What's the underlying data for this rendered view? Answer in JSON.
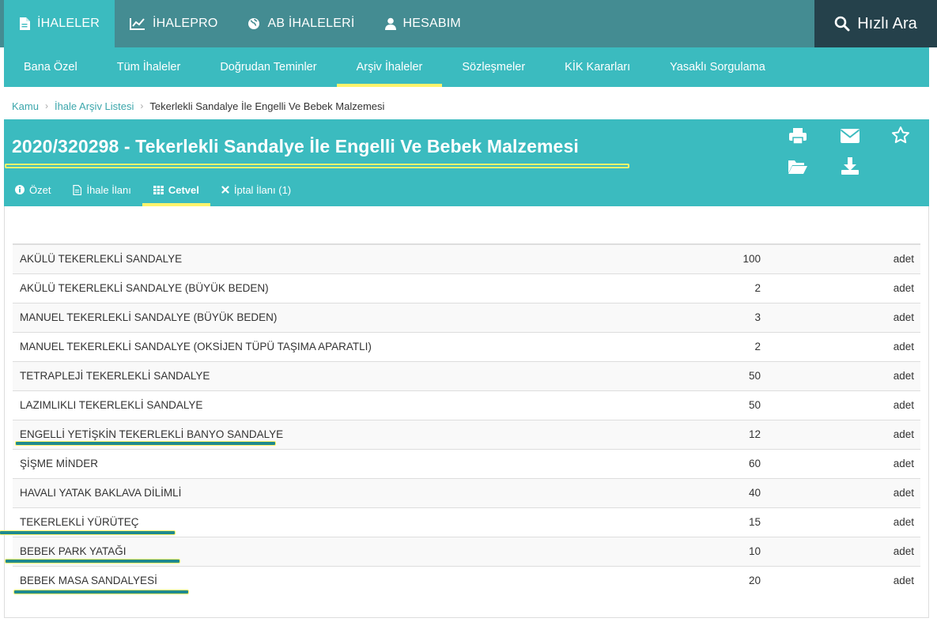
{
  "topnav": {
    "items": [
      {
        "label": "İHALELER",
        "icon": "document-icon",
        "active": true
      },
      {
        "label": "İHALEPRO",
        "icon": "chart-line-icon",
        "active": false
      },
      {
        "label": "AB İHALELERİ",
        "icon": "globe-icon",
        "active": false
      },
      {
        "label": "HESABIM",
        "icon": "user-icon",
        "active": false
      }
    ],
    "quick_search": "Hızlı Ara"
  },
  "subnav": {
    "items": [
      {
        "label": "Bana Özel",
        "active": false
      },
      {
        "label": "Tüm İhaleler",
        "active": false
      },
      {
        "label": "Doğrudan Teminler",
        "active": false
      },
      {
        "label": "Arşiv İhaleler",
        "active": true
      },
      {
        "label": "Sözleşmeler",
        "active": false
      },
      {
        "label": "KİK Kararları",
        "active": false
      },
      {
        "label": "Yasaklı Sorgulama",
        "active": false
      }
    ]
  },
  "breadcrumb": {
    "items": [
      "Kamu",
      "İhale Arşiv Listesi"
    ],
    "current": "Tekerlekli Sandalye İle Engelli Ve Bebek Malzemesi"
  },
  "header": {
    "title": "2020/320298 - Tekerlekli Sandalye İle Engelli Ve Bebek Malzemesi",
    "actions": [
      "print-icon",
      "envelope-icon",
      "star-icon",
      "folder-open-icon",
      "download-icon"
    ]
  },
  "tabs": [
    {
      "label": "Özet",
      "icon": "info-circle-icon",
      "active": false
    },
    {
      "label": "İhale İlanı",
      "icon": "file-icon",
      "active": false
    },
    {
      "label": "Cetvel",
      "icon": "grid-icon",
      "active": true
    },
    {
      "label": "İptal İlanı (1)",
      "icon": "close-icon",
      "active": false
    }
  ],
  "items": [
    {
      "name": "AKÜLÜ TEKERLEKLİ SANDALYE",
      "qty": "100",
      "unit": "adet"
    },
    {
      "name": "AKÜLÜ TEKERLEKLİ SANDALYE (BÜYÜK BEDEN)",
      "qty": "2",
      "unit": "adet"
    },
    {
      "name": "MANUEL TEKERLEKLİ SANDALYE (BÜYÜK BEDEN)",
      "qty": "3",
      "unit": "adet"
    },
    {
      "name": "MANUEL TEKERLEKLİ SANDALYE (OKSİJEN TÜPÜ TAŞIMA APARATLI)",
      "qty": "2",
      "unit": "adet"
    },
    {
      "name": "TETRAPLEJİ TEKERLEKLİ SANDALYE",
      "qty": "50",
      "unit": "adet"
    },
    {
      "name": "LAZIMLIKLI TEKERLEKLİ SANDALYE",
      "qty": "50",
      "unit": "adet"
    },
    {
      "name": "ENGELLİ YETİŞKİN TEKERLEKLİ BANYO SANDALYE",
      "qty": "12",
      "unit": "adet"
    },
    {
      "name": "ŞİŞME MİNDER",
      "qty": "60",
      "unit": "adet"
    },
    {
      "name": "HAVALI YATAK BAKLAVA DİLİMLİ",
      "qty": "40",
      "unit": "adet"
    },
    {
      "name": "TEKERLEKLİ YÜRÜTEÇ",
      "qty": "15",
      "unit": "adet"
    },
    {
      "name": "BEBEK PARK YATAĞI",
      "qty": "10",
      "unit": "adet"
    },
    {
      "name": "BEBEK MASA SANDALYESİ",
      "qty": "20",
      "unit": "adet"
    }
  ]
}
